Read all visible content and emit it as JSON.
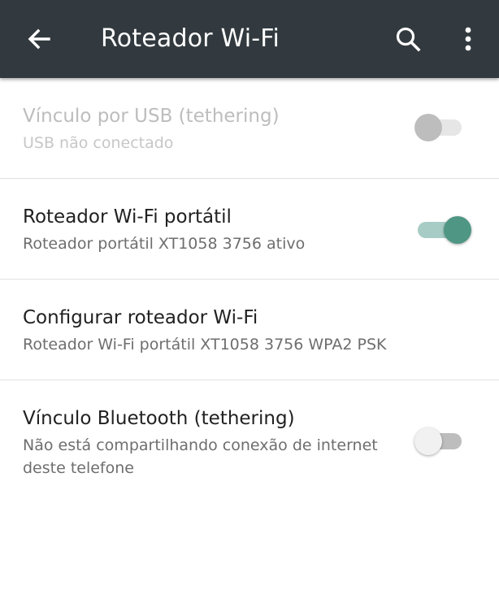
{
  "appbar": {
    "title": "Roteador Wi-Fi",
    "back_icon": "arrow-back-icon",
    "search_icon": "search-icon",
    "more_icon": "more-vert-icon",
    "background": "#323a3f"
  },
  "settings": [
    {
      "label": "Vínculo por USB (tethering)",
      "summary": "USB não conectado",
      "toggle": "off",
      "enabled": false
    },
    {
      "label": "Roteador Wi-Fi portátil",
      "summary": "Roteador portátil XT1058 3756 ativo",
      "toggle": "on",
      "enabled": true
    },
    {
      "label": "Configurar roteador Wi-Fi",
      "summary": "Roteador Wi-Fi portátil XT1058 3756 WPA2 PSK",
      "enabled": true
    },
    {
      "label": "Vínculo Bluetooth (tethering)",
      "summary": "Não está compartilhando conexão de internet deste telefone",
      "toggle": "off",
      "enabled": true
    }
  ],
  "colors": {
    "accent": "#4f9684",
    "accent_track": "#a6ccc5"
  }
}
